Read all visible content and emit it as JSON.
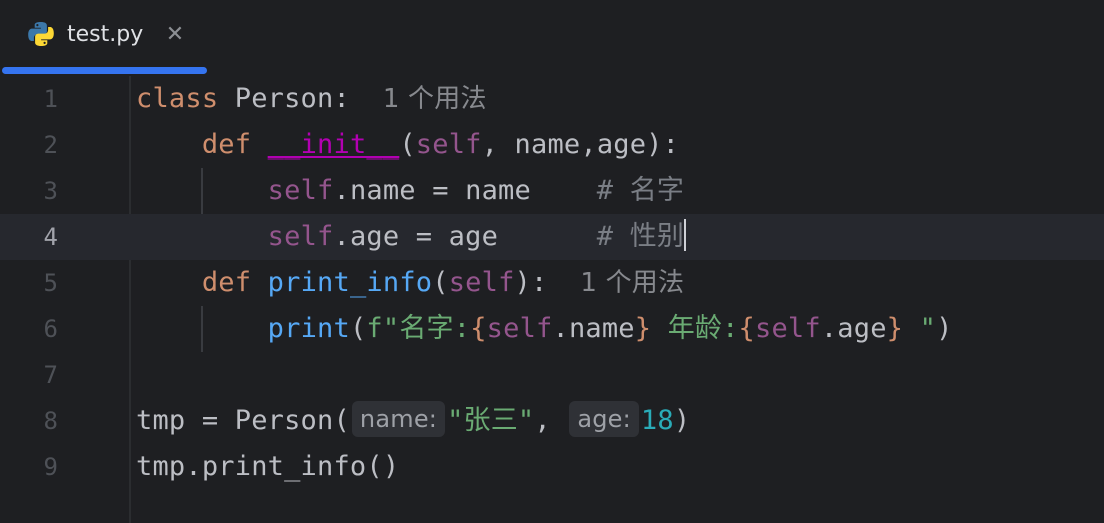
{
  "tab": {
    "filename": "test.py",
    "close_glyph": "✕",
    "icon": "python-icon"
  },
  "editor": {
    "lines": [
      {
        "num": "1"
      },
      {
        "num": "2"
      },
      {
        "num": "3"
      },
      {
        "num": "4"
      },
      {
        "num": "5"
      },
      {
        "num": "6"
      },
      {
        "num": "7"
      },
      {
        "num": "8"
      },
      {
        "num": "9"
      }
    ],
    "usage_hint": "1 个用法",
    "param_hints": {
      "name": "name:",
      "age": "age:"
    },
    "comments": {
      "name": "# 名字",
      "age": "# 性别"
    },
    "strings": {
      "fstring_a": "f\"名字:",
      "fstring_b": " 年龄:",
      "fstring_end": " \"",
      "zhang": "\"张三\""
    },
    "numbers": {
      "age_value": "18"
    }
  },
  "colors": {
    "background": "#1e1f22",
    "accent": "#3574f0",
    "keyword": "#cf8e6d",
    "self": "#94558d",
    "function": "#56a8f5",
    "string": "#6aab73",
    "number": "#2aacb8",
    "comment": "#7a7e85"
  }
}
